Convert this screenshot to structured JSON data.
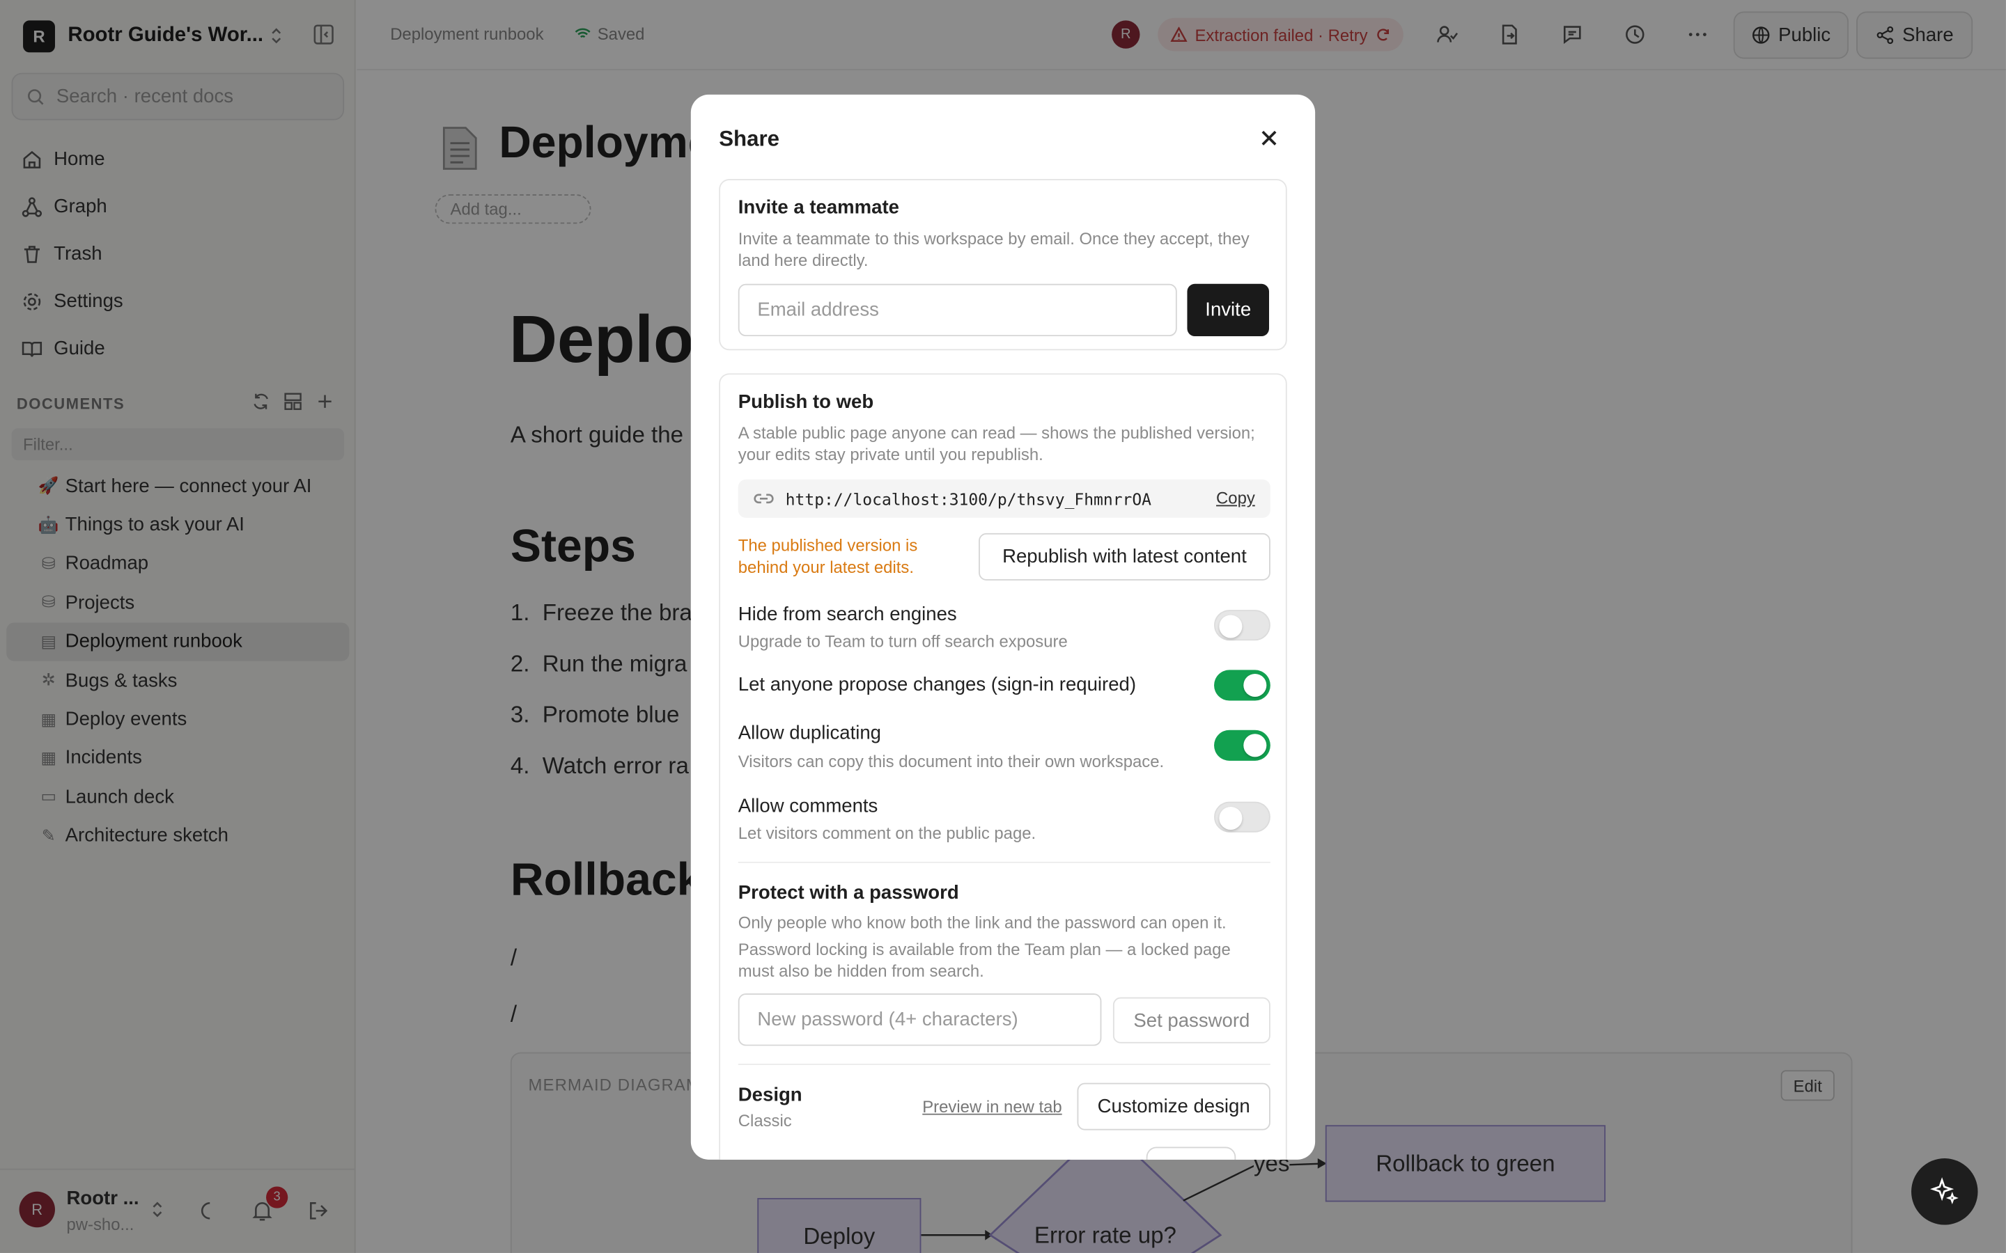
{
  "sidebar": {
    "workspace_initial": "R",
    "workspace_name": "Rootr Guide's Wor...",
    "search_placeholder": "Search · recent docs",
    "nav": [
      {
        "label": "Home",
        "icon": "home-icon"
      },
      {
        "label": "Graph",
        "icon": "graph-icon"
      },
      {
        "label": "Trash",
        "icon": "trash-icon"
      },
      {
        "label": "Settings",
        "icon": "gear-icon"
      },
      {
        "label": "Guide",
        "icon": "book-icon"
      }
    ],
    "documents_title": "DOCUMENTS",
    "filter_placeholder": "Filter...",
    "docs": [
      {
        "label": "Start here — connect your AI",
        "icon": "🚀"
      },
      {
        "label": "Things to ask your AI",
        "icon": "🤖"
      },
      {
        "label": "Roadmap",
        "icon": "⛁"
      },
      {
        "label": "Projects",
        "icon": "⛁"
      },
      {
        "label": "Deployment runbook",
        "icon": "▤"
      },
      {
        "label": "Bugs & tasks",
        "icon": "✲"
      },
      {
        "label": "Deploy events",
        "icon": "▦"
      },
      {
        "label": "Incidents",
        "icon": "▦"
      },
      {
        "label": "Launch deck",
        "icon": "▭"
      },
      {
        "label": "Architecture sketch",
        "icon": "✎"
      }
    ],
    "user_initial": "R",
    "user_name": "Rootr ...",
    "user_sub": "pw-sho...",
    "notifications_count": "3"
  },
  "topbar": {
    "breadcrumb": "Deployment runbook",
    "saved": "Saved",
    "avatar_initial": "R",
    "extraction_status": "Extraction failed · Retry",
    "public_label": "Public",
    "share_label": "Share"
  },
  "doc": {
    "title_top": "Deployment runbook",
    "tag_placeholder": "Add tag...",
    "heading_big": "Deployment runbook",
    "intro": "A short guide the",
    "steps_heading": "Steps",
    "steps": [
      "Freeze the bra",
      "Run the migra",
      "Promote blue",
      "Watch error ra"
    ],
    "rollback_heading": "Rollback",
    "slash_1": "/",
    "slash_2": "/",
    "mermaid_label": "MERMAID DIAGRAM",
    "mermaid_edit": "Edit",
    "nodes": {
      "deploy": "Deploy",
      "error_rate": "Error rate up?",
      "rollback": "Rollback to green",
      "yes": "yes"
    }
  },
  "share_modal": {
    "title": "Share",
    "invite": {
      "heading": "Invite a teammate",
      "description": "Invite a teammate to this workspace by email. Once they accept, they land here directly.",
      "email_placeholder": "Email address",
      "button": "Invite"
    },
    "publish": {
      "heading": "Publish to web",
      "description": "A stable public page anyone can read — shows the published version; your edits stay private until you republish.",
      "url": "http://localhost:3100/p/thsvy_FhmnrrOA",
      "copy": "Copy",
      "warning": "The published version is behind your latest edits.",
      "republish": "Republish with latest content",
      "options": [
        {
          "label": "Hide from search engines",
          "sub": "Upgrade to Team to turn off search exposure",
          "on": false
        },
        {
          "label": "Let anyone propose changes (sign-in required)",
          "sub": "",
          "on": true
        },
        {
          "label": "Allow duplicating",
          "sub": "Visitors can copy this document into their own workspace.",
          "on": true
        },
        {
          "label": "Allow comments",
          "sub": "Let visitors comment on the public page.",
          "on": false
        }
      ],
      "password_heading": "Protect with a password",
      "password_desc_1": "Only people who know both the link and the password can open it.",
      "password_desc_2": "Password locking is available from the Team plan — a locked page must also be hidden from search.",
      "password_placeholder": "New password (4+ characters)",
      "set_password": "Set password",
      "design_heading": "Design",
      "design_value": "Classic",
      "preview_link": "Preview in new tab",
      "customize": "Customize design"
    }
  },
  "colors": {
    "accent_green": "#12a150",
    "warning": "#d97a12",
    "error": "#c94040",
    "dark": "#1a1a1a"
  }
}
